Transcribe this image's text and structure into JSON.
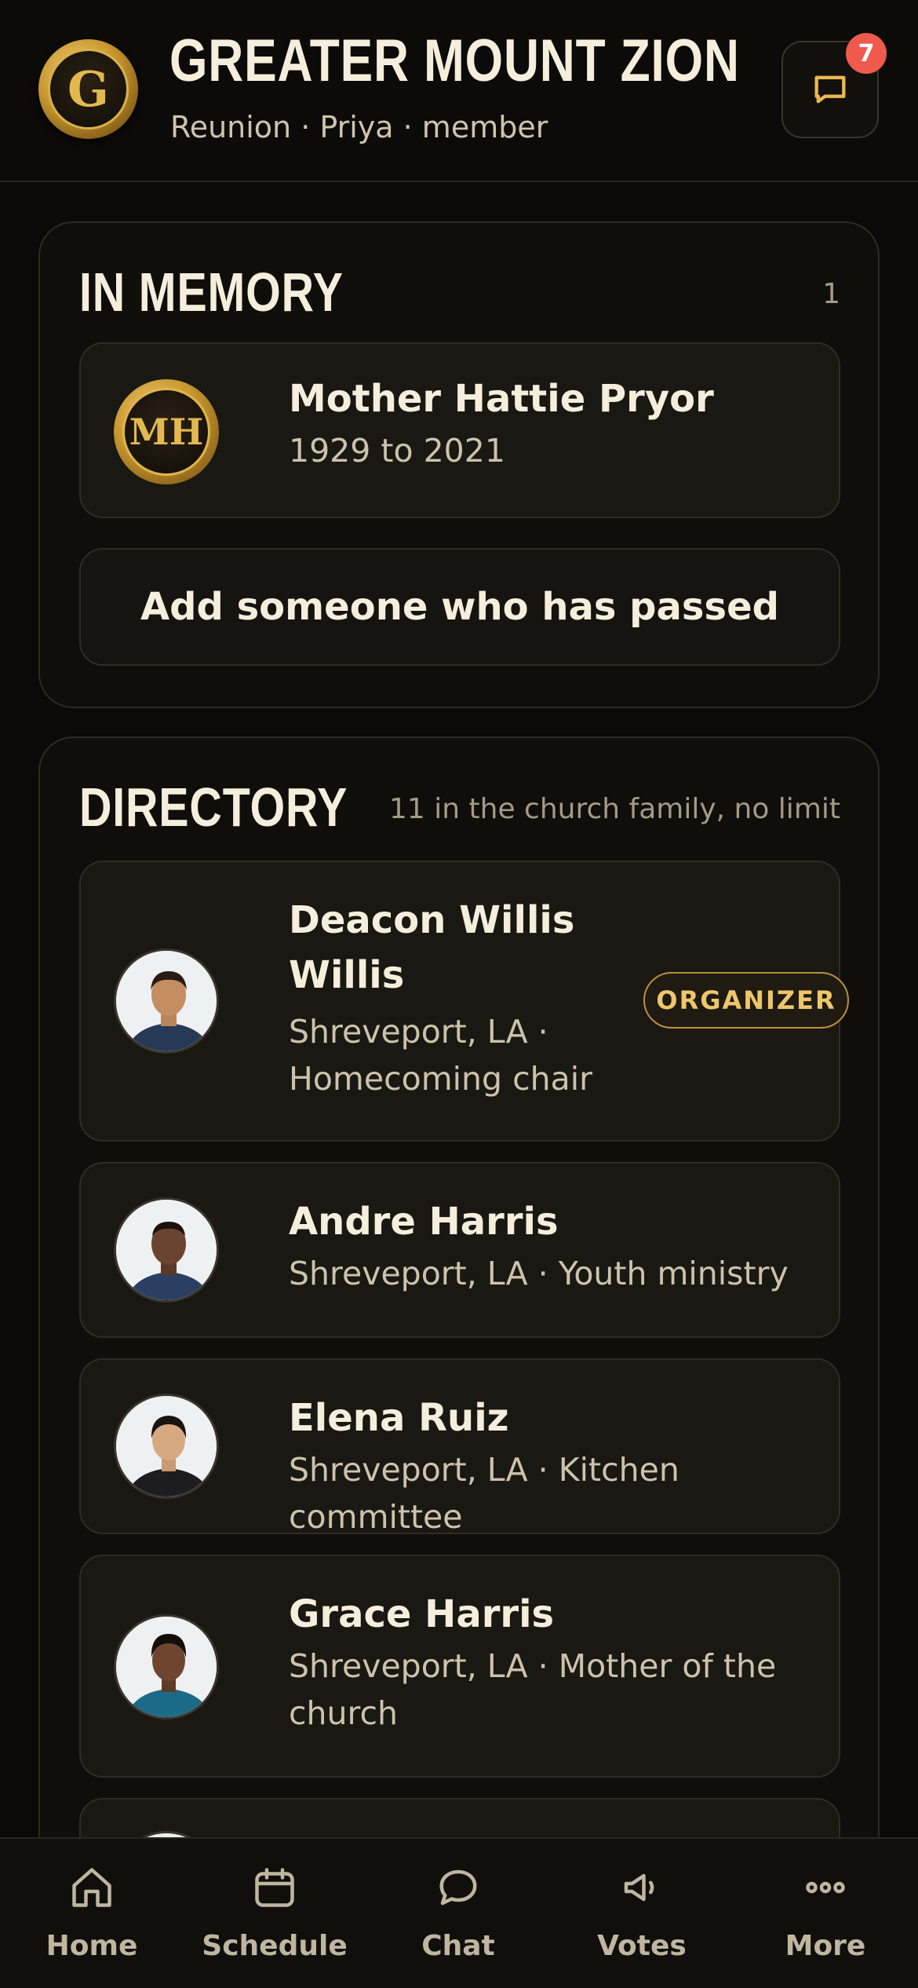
{
  "header": {
    "logo_letter": "G",
    "title": "GREATER MOUNT ZION",
    "subtitle": "Reunion · Priya · member",
    "chat_badge_count": "7",
    "chat_icon": "message-square-icon"
  },
  "memory": {
    "title": "IN MEMORY",
    "count": "1",
    "entries": [
      {
        "initials": "MH",
        "name": "Mother Hattie Pryor",
        "years": "1929 to 2021"
      }
    ],
    "add_label": "Add someone who has passed"
  },
  "directory": {
    "title": "DIRECTORY",
    "meta": "11 in the church family, no limit",
    "members": [
      {
        "name_line1": "Deacon Willis",
        "name_line2": "Willis",
        "detail_line1": "Shreveport, LA ·",
        "detail_line2": "Homecoming chair",
        "badge": "ORGANIZER"
      },
      {
        "name": "Andre Harris",
        "detail": "Shreveport, LA · Youth ministry"
      },
      {
        "name": "Elena Ruiz",
        "detail": "Shreveport, LA · Kitchen committee"
      },
      {
        "name": "Grace Harris",
        "detail_line1": "Shreveport, LA · Mother of the",
        "detail_line2": "church"
      }
    ]
  },
  "nav": {
    "items": [
      {
        "label": "Home",
        "icon": "home-icon"
      },
      {
        "label": "Schedule",
        "icon": "calendar-icon"
      },
      {
        "label": "Chat",
        "icon": "chat-bubble-icon"
      },
      {
        "label": "Votes",
        "icon": "megaphone-icon"
      },
      {
        "label": "More",
        "icon": "more-dots-icon"
      }
    ]
  },
  "colors": {
    "background": "#0b0a08",
    "card": "#1a1813",
    "gold_accent": "#eec66b",
    "badge_red": "#ef5a4c",
    "text_primary": "#f6eedc",
    "text_secondary": "#cdc2ab"
  }
}
